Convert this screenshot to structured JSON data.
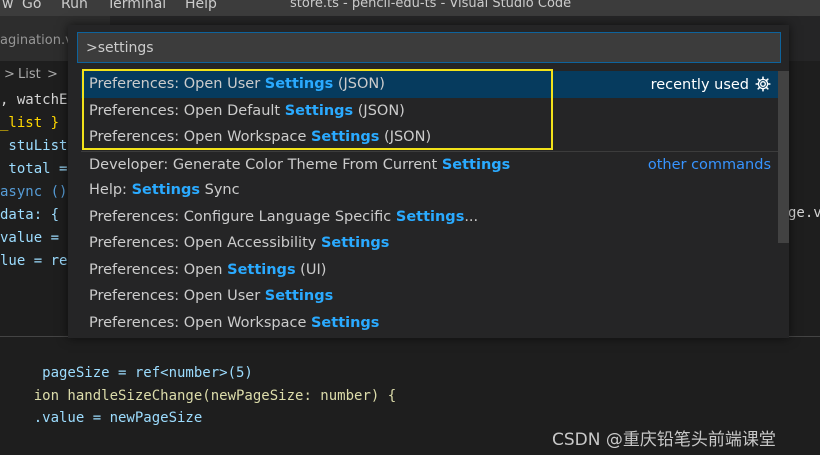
{
  "menu": {
    "items": [
      "w",
      "Go",
      "Run",
      "Terminal",
      "Help"
    ]
  },
  "window_title": "store.ts - pencil-edu-ts - Visual Studio Code",
  "tab": {
    "label": "agination.v"
  },
  "breadcrumb": {
    "parts": [
      ">",
      "List",
      ">"
    ]
  },
  "code_top": [
    ", watchE",
    "_list }",
    " stuList",
    " total =",
    "async ()",
    "data: {",
    "value =",
    "lue = re"
  ],
  "code_right": "ge.v",
  "code_bottom": [
    " pageSize = ref<number>(5)",
    "ion handleSizeChange(newPageSize: number) {",
    ".value = newPageSize"
  ],
  "command_palette": {
    "input_value": ">settings",
    "items": [
      {
        "pre": "Preferences: Open User ",
        "hl": "Settings",
        "post": " (JSON)",
        "right": "recently used",
        "active": true
      },
      {
        "pre": "Preferences: Open Default ",
        "hl": "Settings",
        "post": " (JSON)"
      },
      {
        "pre": "Preferences: Open Workspace ",
        "hl": "Settings",
        "post": " (JSON)"
      },
      {
        "pre": "Developer: Generate Color Theme From Current ",
        "hl": "Settings",
        "post": "",
        "right": "other commands"
      },
      {
        "pre": "Help: ",
        "hl": "Settings",
        "post": " Sync"
      },
      {
        "pre": "Preferences: Configure Language Specific ",
        "hl": "Settings",
        "post": "..."
      },
      {
        "pre": "Preferences: Open Accessibility ",
        "hl": "Settings",
        "post": ""
      },
      {
        "pre": "Preferences: Open ",
        "hl": "Settings",
        "post": " (UI)"
      },
      {
        "pre": "Preferences: Open User ",
        "hl": "Settings",
        "post": ""
      },
      {
        "pre": "Preferences: Open Workspace ",
        "hl": "Settings",
        "post": ""
      }
    ]
  },
  "watermark": "CSDN @重庆铅笔头前端课堂",
  "colors": {
    "highlight": "#2aaaff",
    "selection": "#063b5e",
    "annotation_box": "#f2e21a",
    "input_border": "#0e639c"
  }
}
